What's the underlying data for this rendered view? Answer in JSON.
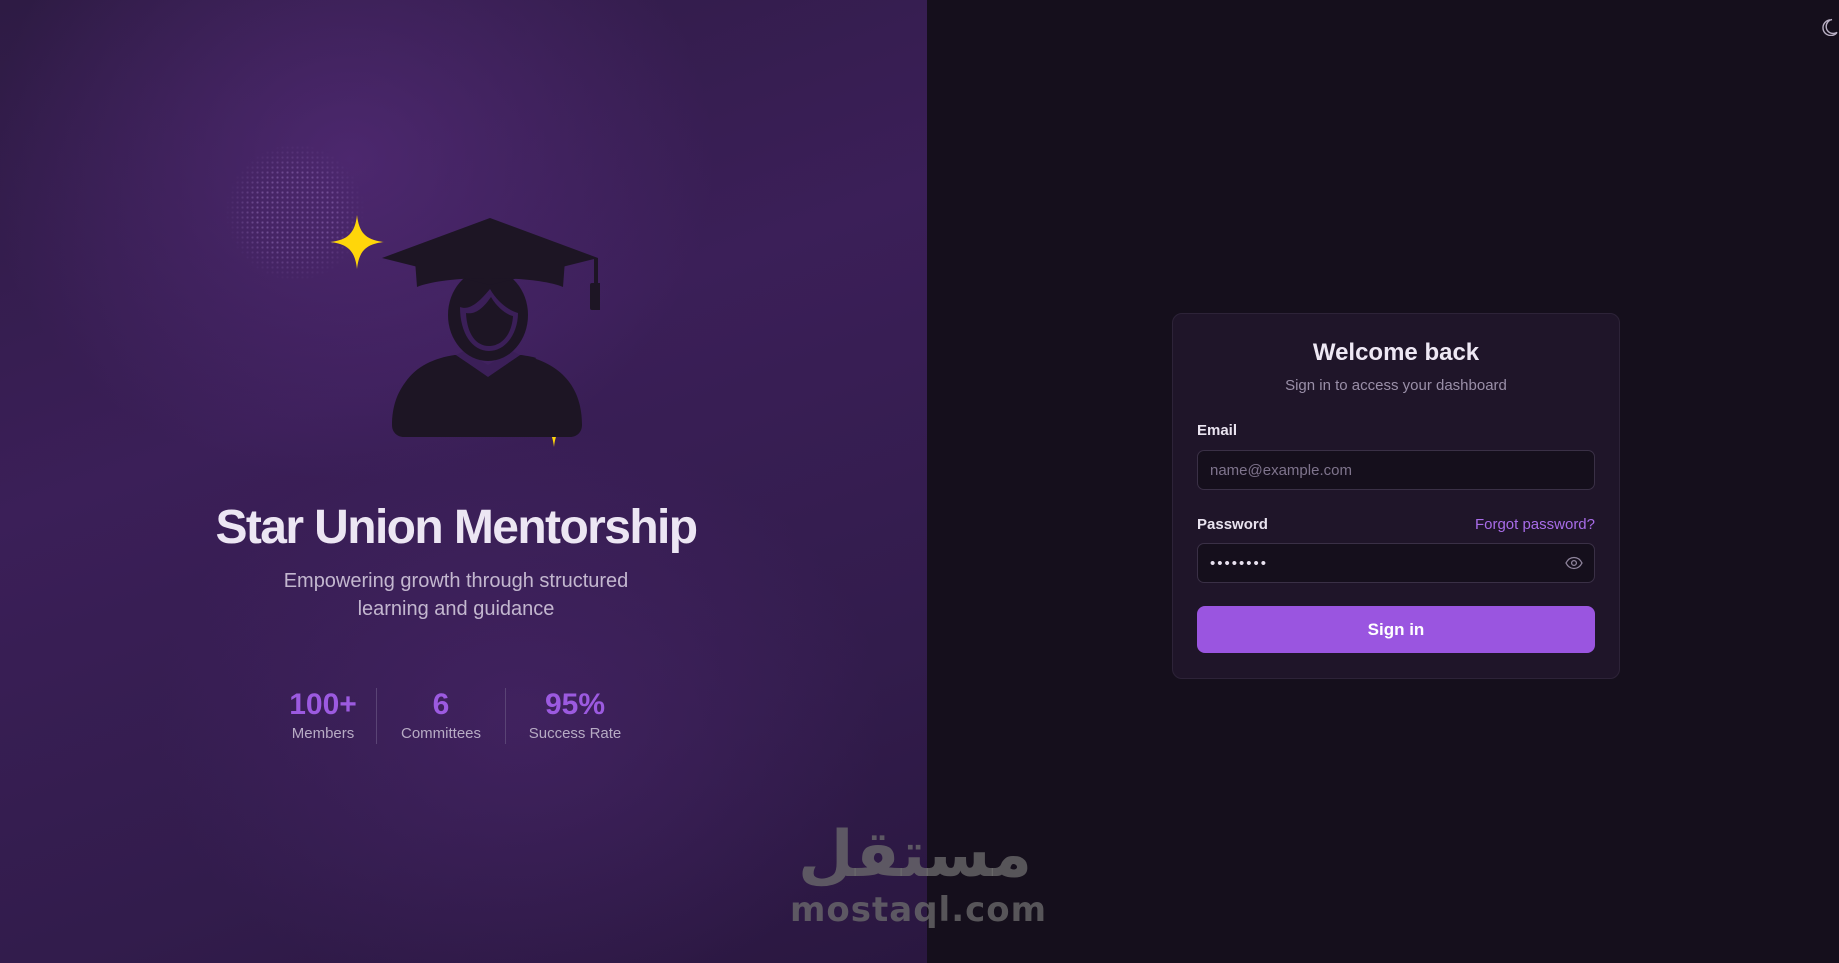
{
  "hero": {
    "title": "Star Union Mentorship",
    "subtitle": "Empowering growth through structured learning and guidance",
    "illustration_icon": "graduate-with-sparkles-icon",
    "stats": [
      {
        "value": "100+",
        "label": "Members"
      },
      {
        "value": "6",
        "label": "Committees"
      },
      {
        "value": "95%",
        "label": "Success Rate"
      }
    ]
  },
  "header": {
    "theme_toggle_icon": "moon-icon"
  },
  "login": {
    "title": "Welcome back",
    "subtitle": "Sign in to access your dashboard",
    "email_label": "Email",
    "email_placeholder": "name@example.com",
    "email_value": "",
    "password_label": "Password",
    "forgot_password": "Forgot password?",
    "password_value": "••••••••",
    "show_password_icon": "eye-icon",
    "submit_label": "Sign in"
  },
  "watermark": {
    "arabic": "مستقل",
    "latin": "mostaql.com"
  },
  "colors": {
    "accent": "#9a55e0",
    "stat_accent": "#9c5ae0",
    "sparkle": "#ffd60a",
    "hero_bg": "#3b1f58",
    "right_bg": "#150f1c",
    "card_bg": "#1f1529"
  }
}
